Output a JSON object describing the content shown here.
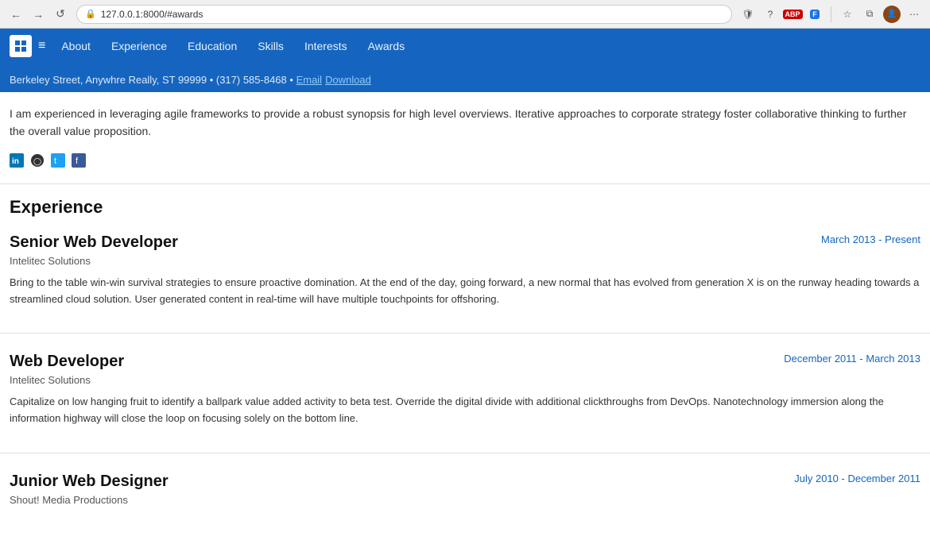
{
  "browser": {
    "back_label": "←",
    "forward_label": "→",
    "refresh_label": "↺",
    "url": "127.0.0.1:8000/#awards",
    "lock_icon": "🔒",
    "extensions": [
      {
        "label": "ABP",
        "color": "red"
      },
      {
        "label": "F",
        "color": "blue"
      }
    ],
    "star_icon": "☆",
    "collection_icon": "⧉",
    "profile_label": "👤",
    "more_icon": "⋯"
  },
  "navbar": {
    "brand": "≡",
    "toggle": "≡",
    "links": [
      {
        "label": "About",
        "href": "#about"
      },
      {
        "label": "Experience",
        "href": "#experience"
      },
      {
        "label": "Education",
        "href": "#education"
      },
      {
        "label": "Skills",
        "href": "#skills"
      },
      {
        "label": "Interests",
        "href": "#interests"
      },
      {
        "label": "Awards",
        "href": "#awards"
      }
    ]
  },
  "partial_header": {
    "text": "Berkeley Street, Anywhre Really, ST 99999 • (317) 585-8468 •",
    "link1": "Email",
    "link2": "Download"
  },
  "bio": {
    "text": "I am experienced in leveraging agile frameworks to provide a robust synopsis for high level overviews. Iterative approaches to corporate strategy foster collaborative thinking to further the overall value proposition."
  },
  "social": [
    {
      "name": "linkedin",
      "icon": "in",
      "href": "#"
    },
    {
      "name": "github",
      "icon": "⊙",
      "href": "#"
    },
    {
      "name": "twitter",
      "icon": "t",
      "href": "#"
    },
    {
      "name": "facebook",
      "icon": "f",
      "href": "#"
    }
  ],
  "experience": {
    "section_title": "Experience",
    "items": [
      {
        "title": "Senior Web Developer",
        "company": "Intelitec Solutions",
        "date": "March 2013 - Present",
        "description": "Bring to the table win-win survival strategies to ensure proactive domination. At the end of the day, going forward, a new normal that has evolved from generation X is on the runway heading towards a streamlined cloud solution. User generated content in real-time will have multiple touchpoints for offshoring."
      },
      {
        "title": "Web Developer",
        "company": "Intelitec Solutions",
        "date": "December 2011 - March 2013",
        "description": "Capitalize on low hanging fruit to identify a ballpark value added activity to beta test. Override the digital divide with additional clickthroughs from DevOps. Nanotechnology immersion along the information highway will close the loop on focusing solely on the bottom line."
      },
      {
        "title": "Junior Web Designer",
        "company": "Shout! Media Productions",
        "date": "July 2010 - December 2011",
        "description": ""
      }
    ]
  }
}
